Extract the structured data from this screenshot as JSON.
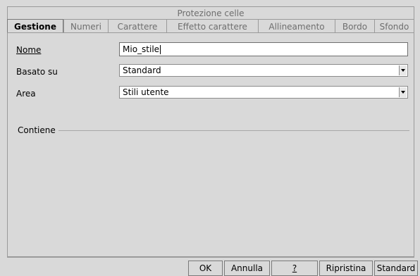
{
  "tabs_row1": [
    "Protezione celle"
  ],
  "tabs_row2": [
    "Gestione",
    "Numeri",
    "Carattere",
    "Effetto carattere",
    "Allineamento",
    "Bordo",
    "Sfondo"
  ],
  "active_tab": "Gestione",
  "form": {
    "name_label": "Nome",
    "name_value": "Mio_stile",
    "based_label": "Basato su",
    "based_value": "Standard",
    "area_label": "Area",
    "area_value": "Stili utente",
    "contains_label": "Contiene"
  },
  "buttons": {
    "ok": "OK",
    "cancel": "Annulla",
    "help": "?",
    "reset": "Ripristina",
    "standard": "Standard"
  }
}
